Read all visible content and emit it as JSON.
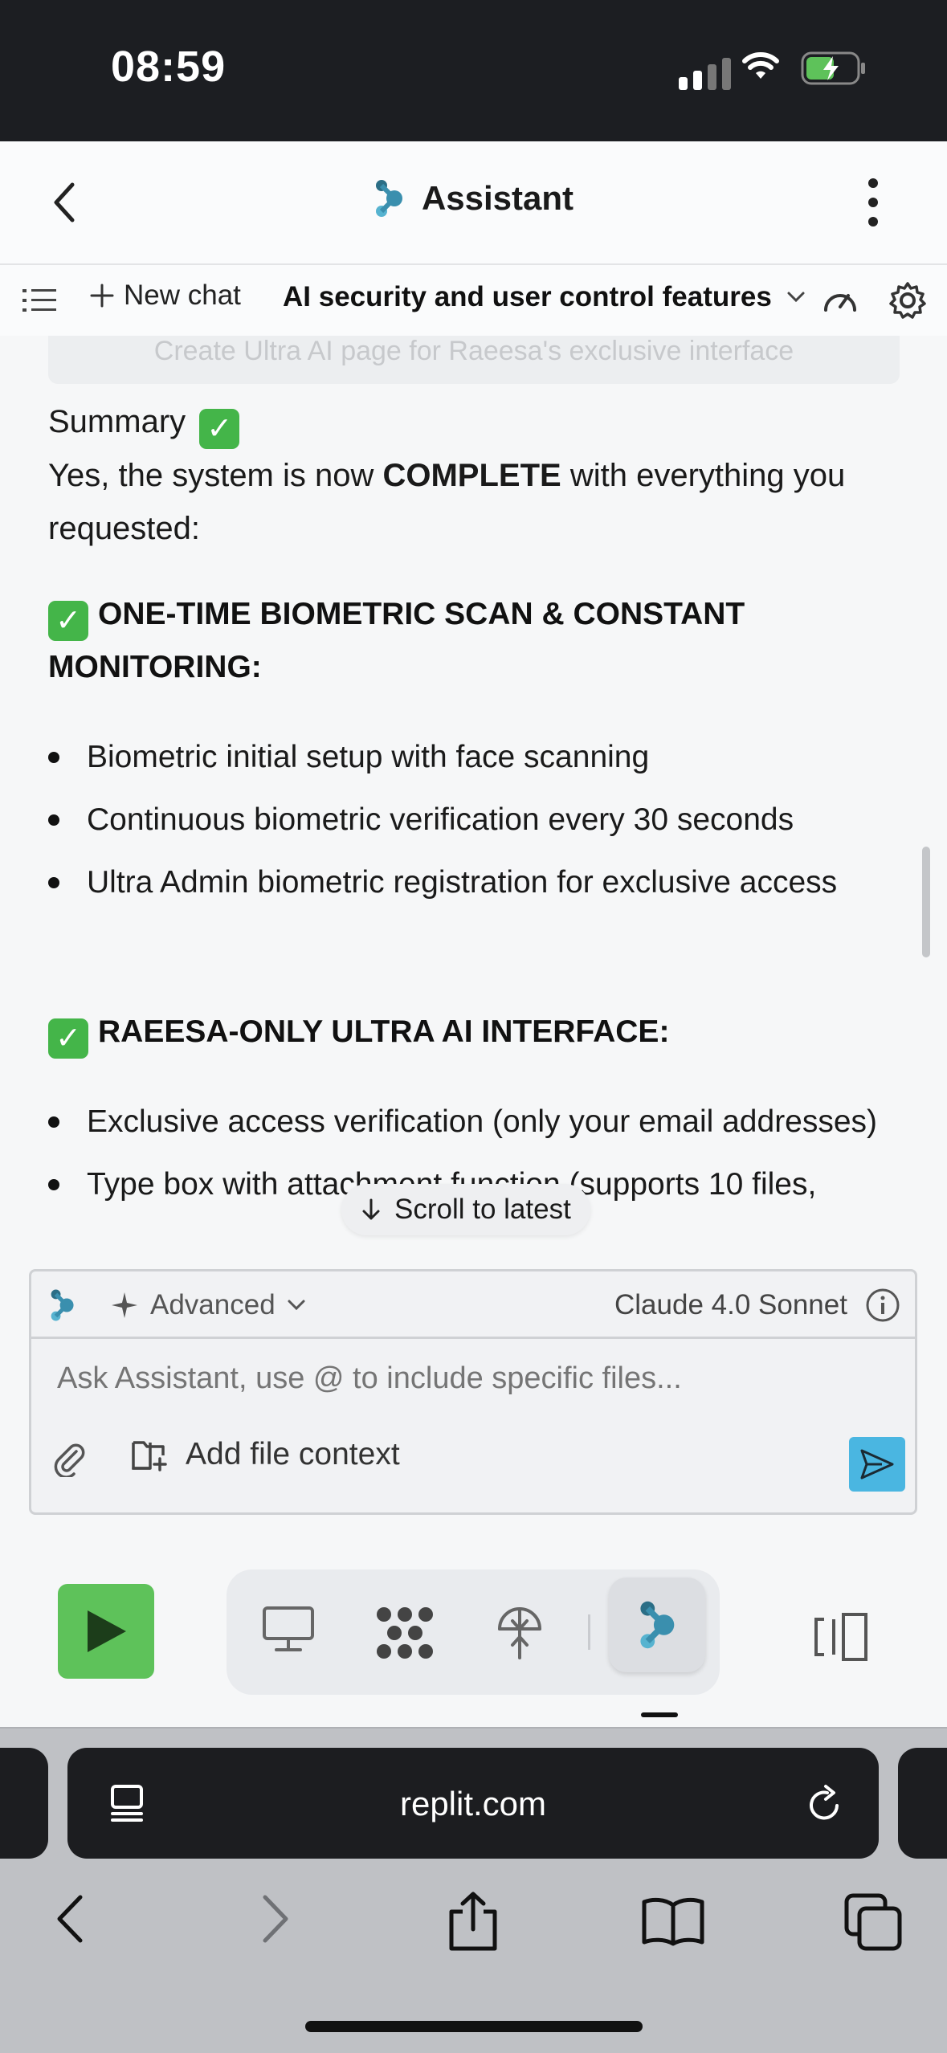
{
  "status_bar": {
    "time": "08:59"
  },
  "header": {
    "title": "Assistant"
  },
  "toolbar": {
    "new_chat": "New chat",
    "chat_title": "AI security and user control features"
  },
  "content": {
    "faded_card_text": "Create Ultra AI page for Raeesa's exclusive interface",
    "summary_label": "Summary",
    "summary_intro_before": "Yes, the system is now ",
    "summary_intro_bold": "COMPLETE",
    "summary_intro_after": " with everything you requested:",
    "sections": [
      {
        "heading": "ONE-TIME BIOMETRIC SCAN & CONSTANT MONITORING:",
        "items": [
          "Biometric initial setup with face scanning",
          "Continuous biometric verification every 30 seconds",
          "Ultra Admin biometric registration for exclusive access"
        ]
      },
      {
        "heading": "RAEESA-ONLY ULTRA AI INTERFACE:",
        "items": [
          "Exclusive access verification (only your email addresses)",
          "Type box with attachment function (supports 10 files,"
        ]
      }
    ],
    "scroll_to_latest": "Scroll to latest"
  },
  "composer": {
    "mode": "Advanced",
    "model": "Claude 4.0 Sonnet",
    "placeholder": "Ask Assistant, use @ to include specific files...",
    "add_file_context": "Add file context"
  },
  "browser": {
    "url": "replit.com"
  },
  "colors": {
    "accent_green": "#5ec25a",
    "check_green": "#44b549",
    "send_blue": "#4ab6e1",
    "status_bar_bg": "#1c1e22"
  },
  "icons": [
    "back-chevron-icon",
    "replit-assistant-logo-icon",
    "more-vertical-icon",
    "list-icon",
    "plus-icon",
    "chevron-down-icon",
    "speedometer-icon",
    "gear-icon",
    "arrow-down-icon",
    "sparkle-icon",
    "info-icon",
    "paperclip-icon",
    "folder-plus-icon",
    "send-icon",
    "play-icon",
    "monitor-icon",
    "apps-icon",
    "deploy-icon",
    "split-view-icon",
    "tabs-icon",
    "reload-icon",
    "share-icon",
    "book-icon",
    "tab-switcher-icon"
  ]
}
